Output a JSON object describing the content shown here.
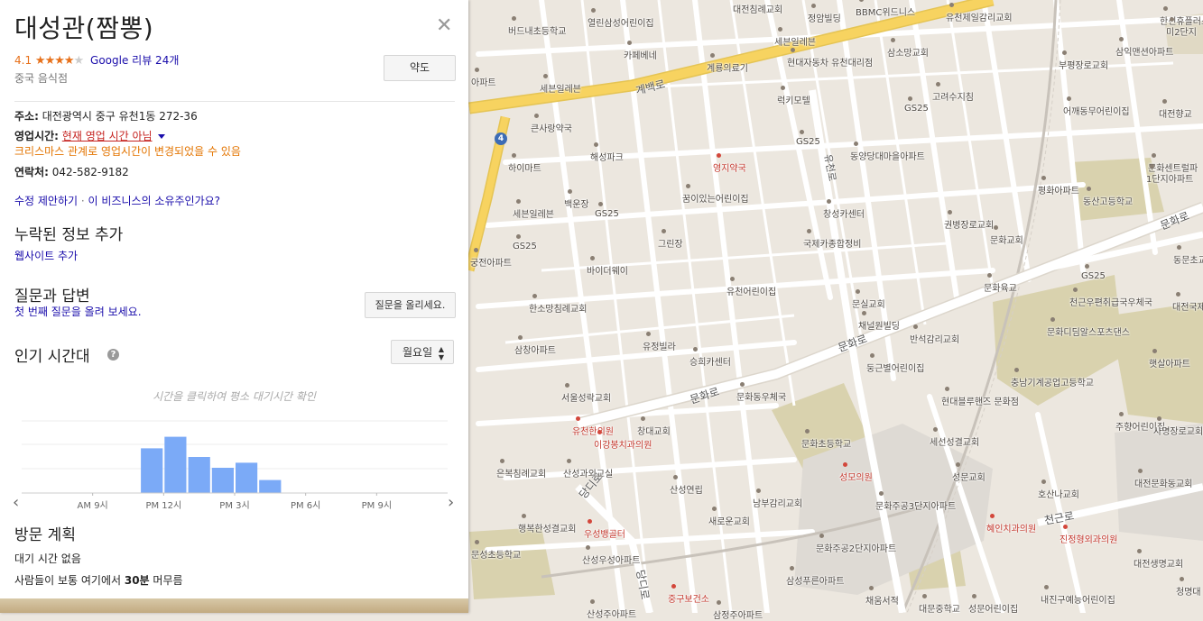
{
  "place": {
    "title": "대성관(짬뽕)",
    "rating_value": "4.1",
    "rating_stars": 4,
    "reviews_label": "Google 리뷰 24개",
    "category": "중국 음식점",
    "directions_button": "약도",
    "close_icon": "close-icon"
  },
  "info": {
    "address_label": "주소:",
    "address_value": "대전광역시 중구 유천1동 272-36",
    "hours_label": "영업시간:",
    "hours_value": "현재 영업 시간 아님",
    "hours_notice": "크리스마스 관계로 영업시간이 변경되었을 수 있음",
    "phone_label": "연락처:",
    "phone_value": "042-582-9182",
    "suggest_edit": "수정 제안하기",
    "separator": "·",
    "claim_business": "이 비즈니스의 소유주인가요?"
  },
  "missing_info": {
    "heading": "누락된 정보 추가",
    "add_website": "웹사이트 추가"
  },
  "qa": {
    "heading": "질문과 답변",
    "ask_first": "첫 번째 질문을 올려 보세요.",
    "ask_button": "질문을 올리세요."
  },
  "popular_times": {
    "heading": "인기 시간대",
    "help_icon": "help-icon",
    "day_select": "월요일",
    "hint": "시간을 클릭하여 평소 대기시간 확인",
    "prev_icon": "chevron-left-icon",
    "next_icon": "chevron-right-icon"
  },
  "chart_data": {
    "type": "bar",
    "x_labels": [
      "AM 9시",
      "PM 12시",
      "PM 3시",
      "PM 6시",
      "PM 9시"
    ],
    "hours": [
      6,
      7,
      8,
      9,
      10,
      11,
      12,
      13,
      14,
      15,
      16,
      17,
      18,
      19,
      20,
      21,
      22,
      23
    ],
    "values": [
      0,
      0,
      0,
      0,
      0,
      62,
      78,
      50,
      35,
      42,
      18,
      0,
      0,
      0,
      0,
      0,
      0,
      0
    ],
    "bar_color": "#7baaf7",
    "ylim": [
      0,
      100
    ]
  },
  "visit_plan": {
    "heading": "방문 계획",
    "wait_time": "대기 시간 없음",
    "stay_prefix": "사람들이 보통 여기에서 ",
    "stay_value": "30분",
    "stay_suffix": " 머무름"
  },
  "map": {
    "route_number": "4",
    "road_labels": [
      "계백로",
      "유천로",
      "문화로",
      "문화로",
      "당디로",
      "천근로",
      "문화로",
      "당디로"
    ],
    "labels": [
      {
        "text": "대전침례교회",
        "red": false
      },
      {
        "text": "정암빌딩",
        "red": false
      },
      {
        "text": "BBMC위드니스",
        "red": false
      },
      {
        "text": "유천제일감리교회",
        "red": false
      },
      {
        "text": "한신휴플러스",
        "red": false
      },
      {
        "text": "미2단지",
        "red": false
      },
      {
        "text": "열린삼성어린이집",
        "red": false
      },
      {
        "text": "버드내초등학교",
        "red": false
      },
      {
        "text": "세븐일레븐",
        "red": false
      },
      {
        "text": "삼소망교회",
        "red": false
      },
      {
        "text": "삼익맨션아파트",
        "red": false
      },
      {
        "text": "카페베네",
        "red": false
      },
      {
        "text": "현대자동차 유천대리점",
        "red": false
      },
      {
        "text": "계룡의료기",
        "red": false
      },
      {
        "text": "부평장로교회",
        "red": false
      },
      {
        "text": "아파트",
        "red": false
      },
      {
        "text": "세븐일레븐",
        "red": false
      },
      {
        "text": "럭키모텔",
        "red": false
      },
      {
        "text": "고려수지침",
        "red": false
      },
      {
        "text": "큰사랑약국",
        "red": false
      },
      {
        "text": "GS25",
        "red": false
      },
      {
        "text": "어깨동무어린이집",
        "red": false
      },
      {
        "text": "대전향교",
        "red": false
      },
      {
        "text": "GS25",
        "red": false
      },
      {
        "text": "하이마트",
        "red": false
      },
      {
        "text": "해성파크",
        "red": false
      },
      {
        "text": "영지약국",
        "red": true
      },
      {
        "text": "동양당대마을아파트",
        "red": false
      },
      {
        "text": "문화센트럴파",
        "red": false
      },
      {
        "text": "1단지아파트",
        "red": false
      },
      {
        "text": "꿈이있는어린이집",
        "red": false
      },
      {
        "text": "평화아파트",
        "red": false
      },
      {
        "text": "동산고등학교",
        "red": false
      },
      {
        "text": "세븐일레븐",
        "red": false
      },
      {
        "text": "백운장",
        "red": false
      },
      {
        "text": "GS25",
        "red": false
      },
      {
        "text": "창성카센터",
        "red": false
      },
      {
        "text": "권병장로교회",
        "red": false
      },
      {
        "text": "그린장",
        "red": false
      },
      {
        "text": "국제카종합정비",
        "red": false
      },
      {
        "text": "문화교회",
        "red": false
      },
      {
        "text": "GS25",
        "red": false
      },
      {
        "text": "궁전아파트",
        "red": false
      },
      {
        "text": "바이더웨이",
        "red": false
      },
      {
        "text": "동문초교",
        "red": false
      },
      {
        "text": "GS25",
        "red": false
      },
      {
        "text": "유천어린이집",
        "red": false
      },
      {
        "text": "문화육교",
        "red": false
      },
      {
        "text": "천근우편취급국우체국",
        "red": false
      },
      {
        "text": "한소망침례교회",
        "red": false
      },
      {
        "text": "문실교회",
        "red": false
      },
      {
        "text": "대전국제",
        "red": false
      },
      {
        "text": "채널원빌딩",
        "red": false
      },
      {
        "text": "문화디딤알스포츠댄스",
        "red": false
      },
      {
        "text": "삼창아파트",
        "red": false
      },
      {
        "text": "유정빌라",
        "red": false
      },
      {
        "text": "반석감리교회",
        "red": false
      },
      {
        "text": "승희카센터",
        "red": false
      },
      {
        "text": "둥근별어린이집",
        "red": false
      },
      {
        "text": "햇살아파트",
        "red": false
      },
      {
        "text": "충남기계공업고등학교",
        "red": false
      },
      {
        "text": "서울성락교회",
        "red": false
      },
      {
        "text": "문화동우체국",
        "red": false
      },
      {
        "text": "현대블루핸즈 문화점",
        "red": false
      },
      {
        "text": "주향어린이집",
        "red": false
      },
      {
        "text": "유천한의원",
        "red": true
      },
      {
        "text": "창대교회",
        "red": false
      },
      {
        "text": "사명장로교회",
        "red": false
      },
      {
        "text": "이강봉치과의원",
        "red": true
      },
      {
        "text": "문화초등학교",
        "red": false
      },
      {
        "text": "세선성결교회",
        "red": false
      },
      {
        "text": "은복침례교회",
        "red": false
      },
      {
        "text": "산성과외교실",
        "red": false
      },
      {
        "text": "성모의원",
        "red": true
      },
      {
        "text": "성문교회",
        "red": false
      },
      {
        "text": "대전문화동교회",
        "red": false
      },
      {
        "text": "산성연립",
        "red": false
      },
      {
        "text": "남부감리교회",
        "red": false
      },
      {
        "text": "문화주공3단지아파트",
        "red": false
      },
      {
        "text": "호산나교회",
        "red": false
      },
      {
        "text": "행복한성결교회",
        "red": false
      },
      {
        "text": "우성뱅골터",
        "red": true
      },
      {
        "text": "새로운교회",
        "red": false
      },
      {
        "text": "혜인치과의원",
        "red": true
      },
      {
        "text": "문성초등학교",
        "red": false
      },
      {
        "text": "산성우성아파트",
        "red": false
      },
      {
        "text": "문화주공2단지아파트",
        "red": false
      },
      {
        "text": "진정형외과의원",
        "red": true
      },
      {
        "text": "대전생명교회",
        "red": false
      },
      {
        "text": "삼성푸른아파트",
        "red": false
      },
      {
        "text": "중구보건소",
        "red": true
      },
      {
        "text": "채움서적",
        "red": false
      },
      {
        "text": "대문중학교",
        "red": false
      },
      {
        "text": "성문어린이집",
        "red": false
      },
      {
        "text": "내진구예능어린이집",
        "red": false
      },
      {
        "text": "청명대",
        "red": false
      },
      {
        "text": "산성주아파트",
        "red": false
      },
      {
        "text": "삼정주아파트",
        "red": false
      }
    ],
    "pin_icon": "map-pin-icon"
  },
  "colors": {
    "map_bg": "#ece7df",
    "road": "#ffffff",
    "arterial": "#f7d360",
    "park": "#d9d0a9",
    "accent_link": "#1a0dab",
    "closed_red": "#c5221f",
    "warn_orange": "#e37400",
    "star_orange": "#e7711b"
  }
}
